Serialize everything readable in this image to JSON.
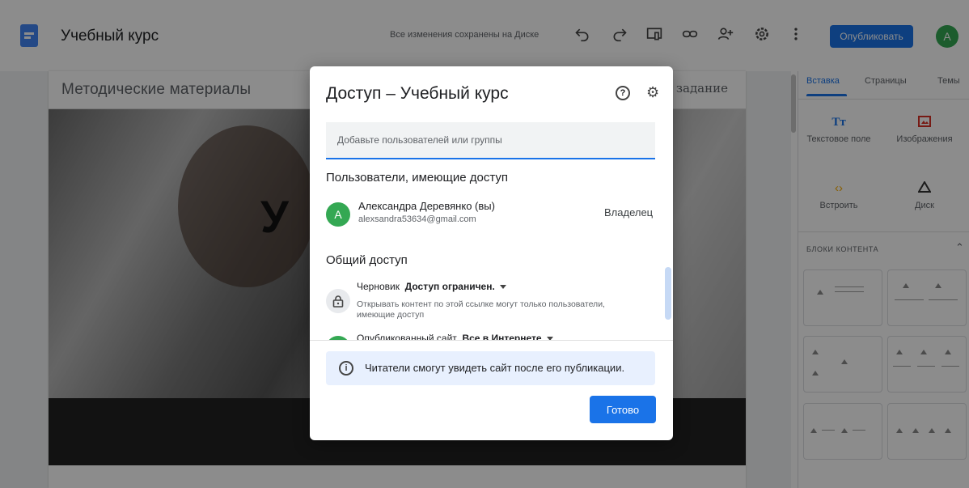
{
  "header": {
    "doc_title": "Учебный курс",
    "save_status": "Все изменения сохранены на Диске",
    "publish_label": "Опубликовать",
    "avatar_letter": "A",
    "icons": [
      "undo-icon",
      "redo-icon",
      "preview-icon",
      "link-icon",
      "share-icon",
      "settings-icon",
      "more-vert-icon"
    ]
  },
  "site": {
    "name": "Методические материалы",
    "nav_item": "е задание",
    "hero_title": "У"
  },
  "side_panel": {
    "tabs": [
      "Вставка",
      "Страницы",
      "Темы"
    ],
    "active_tab": "Вставка",
    "insert_items": [
      {
        "label": "Текстовое поле",
        "icon": "text-box-icon"
      },
      {
        "label": "Изображения",
        "icon": "image-icon"
      },
      {
        "label": "Встроить",
        "icon": "embed-icon"
      },
      {
        "label": "Диск",
        "icon": "drive-icon"
      }
    ],
    "blocks_header": "БЛОКИ КОНТЕНТА"
  },
  "dialog": {
    "title": "Доступ – Учебный курс",
    "add_placeholder": "Добавьте пользователей или группы",
    "users_section": "Пользователи, имеющие доступ",
    "user": {
      "avatar_letter": "A",
      "name": "Александра Деревянко (вы)",
      "email": "alexsandra53634@gmail.com",
      "role": "Владелец"
    },
    "general_section": "Общий доступ",
    "draft_label": "Черновик",
    "draft_value": "Доступ ограничен.",
    "draft_desc": "Открывать контент по этой ссылке могут только пользователи, имеющие доступ",
    "published_label": "Опубликованный сайт",
    "published_value": "Все в Интернете",
    "info_text": "Читатели смогут увидеть сайт после его публикации.",
    "done_label": "Готово"
  },
  "colors": {
    "accent": "#1a73e8",
    "avatar_green": "#34a853",
    "info_bg": "#e8f0fe"
  }
}
